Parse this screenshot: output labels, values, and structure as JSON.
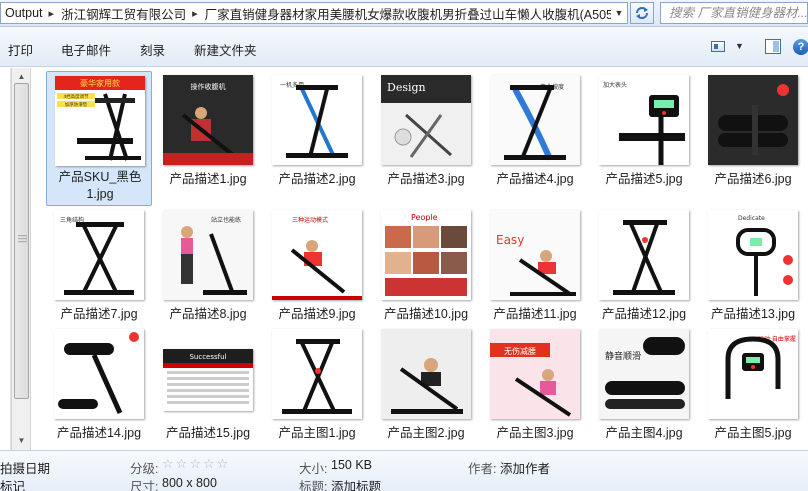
{
  "address_bar": {
    "breadcrumbs": [
      "Output",
      "浙江钢辉工贸有限公司",
      "厂家直销健身器材家用美腰机女爆款收腹机男折叠过山车懒人收腹机(A505)"
    ],
    "search_placeholder": "搜索 厂家直销健身器材..."
  },
  "toolbar": {
    "print": "打印",
    "email": "电子邮件",
    "burn": "刻录",
    "new_folder": "新建文件夹"
  },
  "files": [
    {
      "name": "产品SKU_黑色1.jpg",
      "selected": true,
      "thumb": "sku",
      "banner": "豪华家用款",
      "lines": [
        "4挡高度调节",
        "加厚防滑垫"
      ]
    },
    {
      "name": "产品描述1.jpg",
      "thumb": "d1",
      "banner": "操作收腹机"
    },
    {
      "name": "产品描述2.jpg",
      "thumb": "d2",
      "banner": "一机多用"
    },
    {
      "name": "产品描述3.jpg",
      "thumb": "d3",
      "banner": "Design"
    },
    {
      "name": "产品描述4.jpg",
      "thumb": "d4",
      "banner": "弯曲坡度"
    },
    {
      "name": "产品描述5.jpg",
      "thumb": "d5",
      "banner": "加大表头"
    },
    {
      "name": "产品描述6.jpg",
      "thumb": "d6"
    },
    {
      "name": "产品描述7.jpg",
      "thumb": "d7",
      "banner": "三角结构"
    },
    {
      "name": "产品描述8.jpg",
      "thumb": "d8",
      "banner": "站立也能练"
    },
    {
      "name": "产品描述9.jpg",
      "thumb": "d9",
      "banner": "三种运动模式"
    },
    {
      "name": "产品描述10.jpg",
      "thumb": "d10",
      "banner": "People"
    },
    {
      "name": "产品描述11.jpg",
      "thumb": "d11",
      "banner": "Easy"
    },
    {
      "name": "产品描述12.jpg",
      "thumb": "d12"
    },
    {
      "name": "产品描述13.jpg",
      "thumb": "d13",
      "banner": "Dedicate"
    },
    {
      "name": "产品描述14.jpg",
      "thumb": "d14"
    },
    {
      "name": "产品描述15.jpg",
      "thumb": "d15",
      "banner": "Successful"
    },
    {
      "name": "产品主图1.jpg",
      "thumb": "m1"
    },
    {
      "name": "产品主图2.jpg",
      "thumb": "m2"
    },
    {
      "name": "产品主图3.jpg",
      "thumb": "m3",
      "banner": "无伤减腰"
    },
    {
      "name": "产品主图4.jpg",
      "thumb": "m4",
      "banner": "静音顺滑"
    },
    {
      "name": "产品主图5.jpg",
      "thumb": "m5",
      "banner": "运动·自由掌握"
    }
  ],
  "details": {
    "date_label": "拍摄日期",
    "tag_label": "标记",
    "rating_label": "分级:",
    "rating_stars": 5,
    "dimensions_label": "尺寸:",
    "dimensions_value": "800 x 800",
    "size_label": "大小:",
    "size_value": "150 KB",
    "title_label": "标题:",
    "title_value": "添加标题",
    "author_label": "作者:",
    "author_value": "添加作者"
  }
}
